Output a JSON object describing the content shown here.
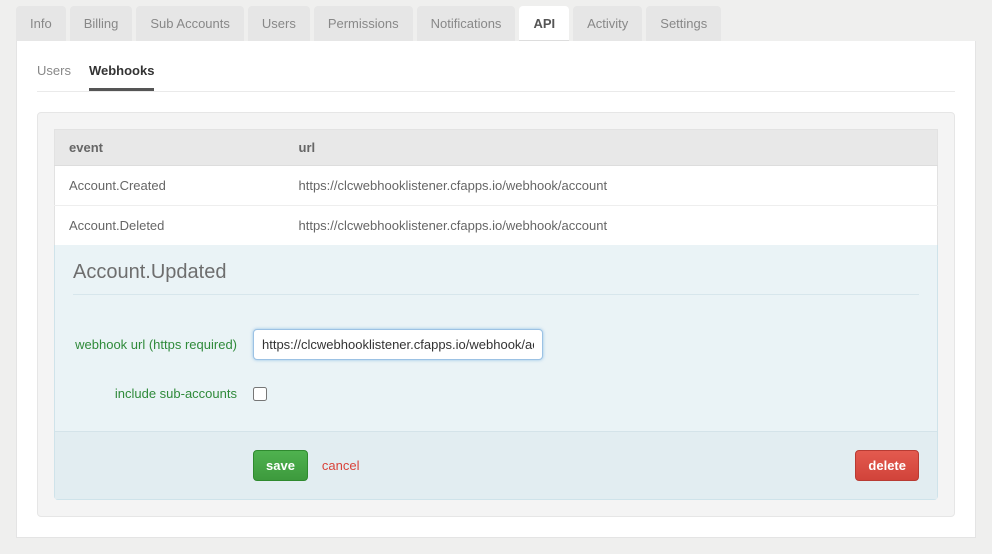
{
  "main_tabs": {
    "items": [
      {
        "label": "Info"
      },
      {
        "label": "Billing"
      },
      {
        "label": "Sub Accounts"
      },
      {
        "label": "Users"
      },
      {
        "label": "Permissions"
      },
      {
        "label": "Notifications"
      },
      {
        "label": "API",
        "active": true
      },
      {
        "label": "Activity"
      },
      {
        "label": "Settings"
      }
    ]
  },
  "sub_tabs": {
    "items": [
      {
        "label": "Users"
      },
      {
        "label": "Webhooks",
        "active": true
      }
    ]
  },
  "webhook_table": {
    "headers": {
      "event": "event",
      "url": "url"
    },
    "rows": [
      {
        "event": "Account.Created",
        "url": "https://clcwebhooklistener.cfapps.io/webhook/account"
      },
      {
        "event": "Account.Deleted",
        "url": "https://clcwebhooklistener.cfapps.io/webhook/account"
      }
    ]
  },
  "editor": {
    "title": "Account.Updated",
    "url_label": "webhook url (https required)",
    "url_value": "https://clcwebhooklistener.cfapps.io/webhook/acc",
    "include_label": "include sub-accounts",
    "include_checked": false,
    "save_label": "save",
    "cancel_label": "cancel",
    "delete_label": "delete"
  }
}
